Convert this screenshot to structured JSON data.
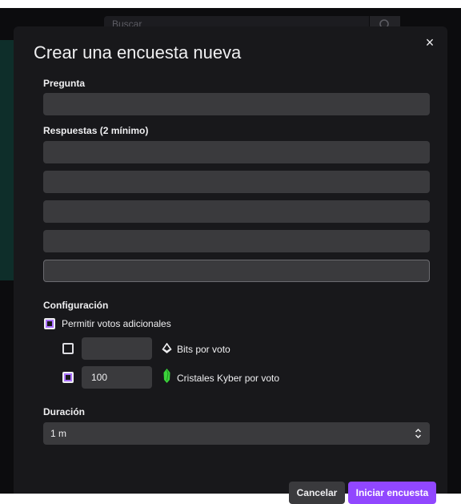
{
  "background": {
    "search_placeholder": "Buscar"
  },
  "modal": {
    "title": "Crear una encuesta nueva",
    "close_glyph": "×",
    "question_label": "Pregunta",
    "answers_label": "Respuestas (2 mínimo)",
    "config_label": "Configuración",
    "extra_votes_label": "Permitir votos adicionales",
    "extra_votes_checked": true,
    "bits": {
      "checked": false,
      "value": "",
      "label": "Bits por voto"
    },
    "kyber": {
      "checked": true,
      "value": "100",
      "label": "Cristales Kyber por voto"
    },
    "duration_label": "Duración",
    "duration_value": "1 m",
    "cancel_label": "Cancelar",
    "start_label": "Iniciar encuesta"
  },
  "colors": {
    "accent": "#9147ff",
    "checkbox_accent": "#a970ff",
    "modal_bg": "#18181b",
    "field_bg": "#3a3a3d",
    "kyber_icon": "#3bd43b"
  }
}
